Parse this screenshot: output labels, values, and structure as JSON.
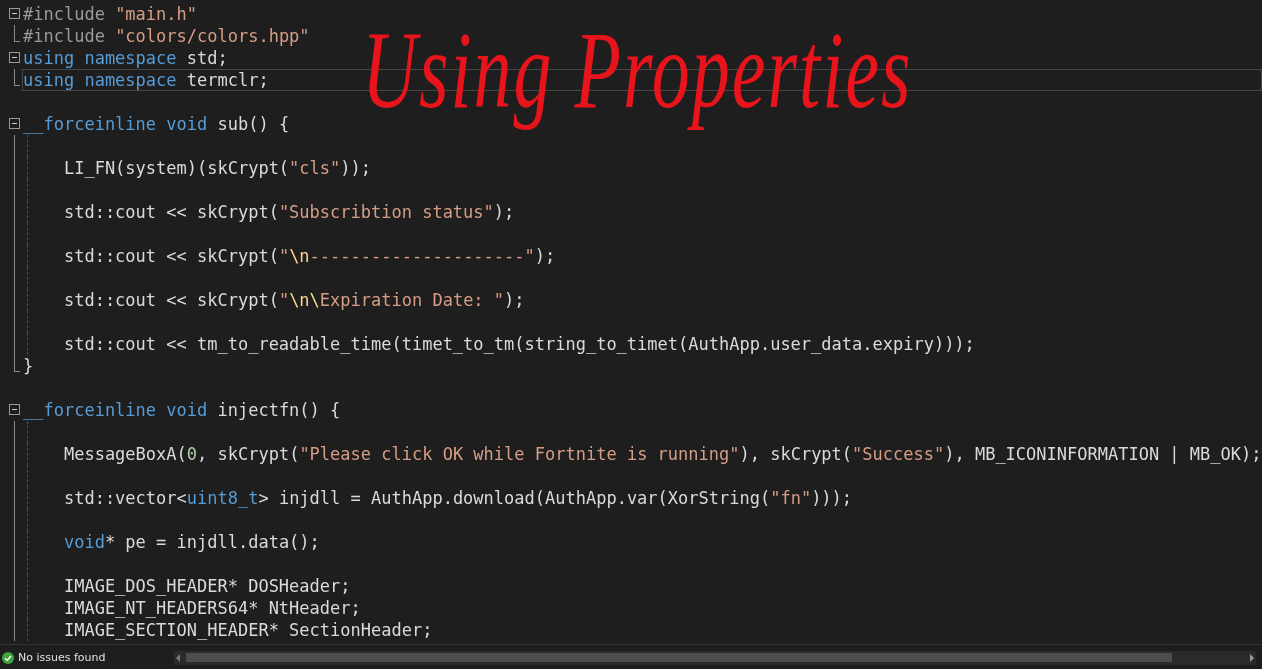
{
  "annotation": "Using Properties",
  "lines": [
    {
      "kind": "start",
      "selected": false,
      "tokens": [
        {
          "kind": "pre",
          "text": "#include"
        },
        {
          "kind": "str",
          "text": " \"main.h\""
        }
      ]
    },
    {
      "kind": "end",
      "selected": false,
      "tokens": [
        {
          "kind": "pre",
          "text": "#include"
        },
        {
          "kind": "str",
          "text": " \"colors/colors.hpp\""
        }
      ]
    },
    {
      "kind": "start",
      "selected": false,
      "tokens": [
        {
          "kind": "kw",
          "text": "using namespace"
        },
        {
          "kind": "id",
          "text": " std;"
        }
      ]
    },
    {
      "kind": "end",
      "selected": true,
      "tokens": [
        {
          "kind": "kw",
          "text": "using namespace"
        },
        {
          "kind": "id",
          "text": " termclr;"
        }
      ]
    },
    {
      "kind": "blank",
      "selected": false
    },
    {
      "kind": "start",
      "selected": false,
      "tokens": [
        {
          "kind": "kw",
          "text": "__forceinline void"
        },
        {
          "kind": "id",
          "text": " sub() {"
        }
      ]
    },
    {
      "kind": "inner",
      "selected": false
    },
    {
      "kind": "inner",
      "selected": false,
      "tokens": [
        {
          "kind": "id",
          "text": "    LI_FN(system)(skCrypt("
        },
        {
          "kind": "str",
          "text": "\"cls\""
        },
        {
          "kind": "id",
          "text": "));"
        }
      ]
    },
    {
      "kind": "inner",
      "selected": false
    },
    {
      "kind": "inner",
      "selected": false,
      "tokens": [
        {
          "kind": "id",
          "text": "    std::cout << skCrypt("
        },
        {
          "kind": "str",
          "text": "\"Subscribtion status\""
        },
        {
          "kind": "id",
          "text": ");"
        }
      ]
    },
    {
      "kind": "inner",
      "selected": false
    },
    {
      "kind": "inner",
      "selected": false,
      "tokens": [
        {
          "kind": "id",
          "text": "    std::cout << skCrypt("
        },
        {
          "kind": "str",
          "text": "\""
        },
        {
          "kind": "esc",
          "text": "\\n"
        },
        {
          "kind": "str",
          "text": "---------------------\""
        },
        {
          "kind": "id",
          "text": ");"
        }
      ]
    },
    {
      "kind": "inner",
      "selected": false
    },
    {
      "kind": "inner",
      "selected": false,
      "tokens": [
        {
          "kind": "id",
          "text": "    std::cout << skCrypt("
        },
        {
          "kind": "str",
          "text": "\""
        },
        {
          "kind": "esc",
          "text": "\\n\\"
        },
        {
          "kind": "str",
          "text": "Expiration Date: \""
        },
        {
          "kind": "id",
          "text": ");"
        }
      ]
    },
    {
      "kind": "inner",
      "selected": false
    },
    {
      "kind": "inner",
      "selected": false,
      "tokens": [
        {
          "kind": "id",
          "text": "    std::cout << tm_to_readable_time(timet_to_tm(string_to_timet(AuthApp.user_data.expiry)));"
        }
      ]
    },
    {
      "kind": "end",
      "selected": false,
      "tokens": [
        {
          "kind": "id",
          "text": "}"
        }
      ]
    },
    {
      "kind": "blank",
      "selected": false
    },
    {
      "kind": "start",
      "selected": false,
      "tokens": [
        {
          "kind": "kw",
          "text": "__forceinline void"
        },
        {
          "kind": "id",
          "text": " injectfn() {"
        }
      ]
    },
    {
      "kind": "inner",
      "selected": false
    },
    {
      "kind": "inner",
      "selected": false,
      "tokens": [
        {
          "kind": "id",
          "text": "    MessageBoxA("
        },
        {
          "kind": "num",
          "text": "0"
        },
        {
          "kind": "id",
          "text": ", skCrypt("
        },
        {
          "kind": "str",
          "text": "\"Please click OK while Fortnite is running\""
        },
        {
          "kind": "id",
          "text": "), skCrypt("
        },
        {
          "kind": "str",
          "text": "\"Success\""
        },
        {
          "kind": "id",
          "text": "), MB_ICONINFORMATION | MB_OK);"
        }
      ]
    },
    {
      "kind": "inner",
      "selected": false
    },
    {
      "kind": "inner",
      "selected": false,
      "tokens": [
        {
          "kind": "id",
          "text": "    std::vector<"
        },
        {
          "kind": "kw",
          "text": "uint8_t"
        },
        {
          "kind": "id",
          "text": "> injdll = AuthApp.download(AuthApp.var(XorString("
        },
        {
          "kind": "str",
          "text": "\"fn\""
        },
        {
          "kind": "id",
          "text": ")));"
        }
      ]
    },
    {
      "kind": "inner",
      "selected": false
    },
    {
      "kind": "inner",
      "selected": false,
      "tokens": [
        {
          "kind": "kw",
          "text": "    void"
        },
        {
          "kind": "id",
          "text": "* pe = injdll.data();"
        }
      ]
    },
    {
      "kind": "inner",
      "selected": false
    },
    {
      "kind": "inner",
      "selected": false,
      "tokens": [
        {
          "kind": "id",
          "text": "    IMAGE_DOS_HEADER* DOSHeader;"
        }
      ]
    },
    {
      "kind": "inner",
      "selected": false,
      "tokens": [
        {
          "kind": "id",
          "text": "    IMAGE_NT_HEADERS64* NtHeader;"
        }
      ]
    },
    {
      "kind": "inner",
      "selected": false,
      "tokens": [
        {
          "kind": "id",
          "text": "    IMAGE_SECTION_HEADER* SectionHeader;"
        }
      ]
    }
  ],
  "status_bar": {
    "message": "No issues found"
  }
}
